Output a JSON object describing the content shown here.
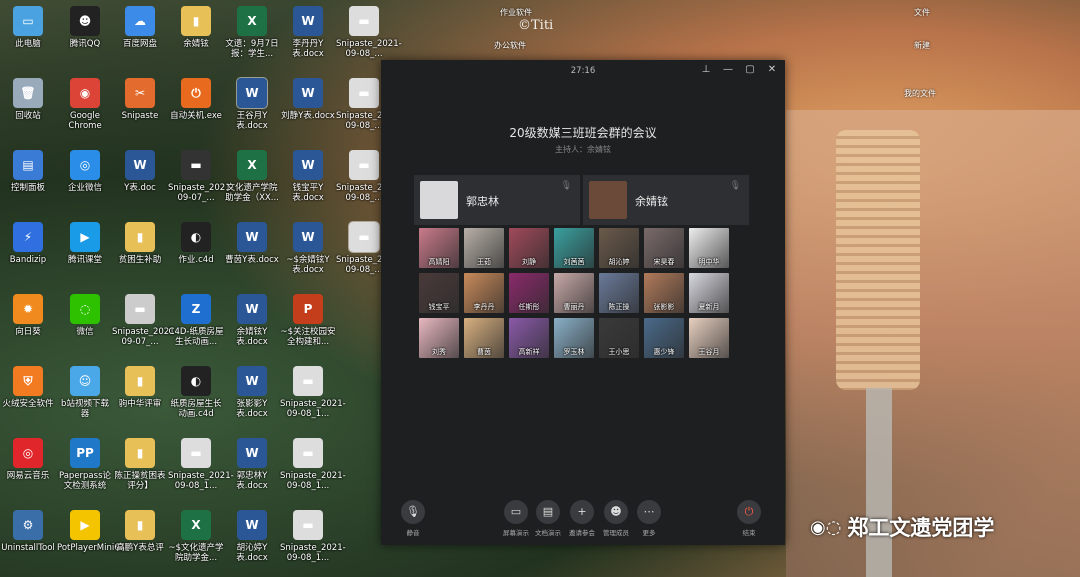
{
  "desktop_icons": [
    {
      "label": "此电脑",
      "color": "#4aa3e0",
      "glyph": "▭",
      "sel": false
    },
    {
      "label": "腾讯QQ",
      "color": "#222",
      "glyph": "☻",
      "sel": false
    },
    {
      "label": "百度网盘",
      "color": "#3d8be8",
      "glyph": "☁",
      "sel": false
    },
    {
      "label": "余婧铉",
      "color": "#e8c058",
      "glyph": "▮",
      "sel": false
    },
    {
      "label": "文遗：9月7日报：学生...",
      "color": "#1e7145",
      "glyph": "X",
      "sel": false
    },
    {
      "label": "李丹丹Y表.docx",
      "color": "#2b5797",
      "glyph": "W",
      "sel": false
    },
    {
      "label": "Snipaste_2021-09-08_...",
      "color": "#ddd",
      "glyph": "▬",
      "sel": false
    },
    {
      "label": "回收站",
      "color": "#9ab",
      "glyph": "🗑",
      "sel": false
    },
    {
      "label": "Google Chrome",
      "color": "#db4437",
      "glyph": "◉",
      "sel": false
    },
    {
      "label": "Snipaste",
      "color": "#e46b2e",
      "glyph": "✂",
      "sel": false
    },
    {
      "label": "自动关机.exe",
      "color": "#e86a1e",
      "glyph": "⏻",
      "sel": false
    },
    {
      "label": "王谷月Y表.docx",
      "color": "#2b5797",
      "glyph": "W",
      "sel": true
    },
    {
      "label": "刘静Y表.docx",
      "color": "#2b5797",
      "glyph": "W",
      "sel": false
    },
    {
      "label": "Snipaste_2021-09-08_...",
      "color": "#ddd",
      "glyph": "▬",
      "sel": false
    },
    {
      "label": "控制面板",
      "color": "#3a7bd5",
      "glyph": "▤",
      "sel": false
    },
    {
      "label": "企业微信",
      "color": "#2a8ee8",
      "glyph": "◎",
      "sel": false
    },
    {
      "label": "Y表.doc",
      "color": "#2b5797",
      "glyph": "W",
      "sel": false
    },
    {
      "label": "Snipaste_2021-09-07_...",
      "color": "#333",
      "glyph": "▬",
      "sel": false
    },
    {
      "label": "文化遗产学院助学金（XX...",
      "color": "#1e7145",
      "glyph": "X",
      "sel": false
    },
    {
      "label": "钱宝平Y表.docx",
      "color": "#2b5797",
      "glyph": "W",
      "sel": false
    },
    {
      "label": "Snipaste_2021-09-08_...",
      "color": "#ddd",
      "glyph": "▬",
      "sel": false
    },
    {
      "label": "Bandizip",
      "color": "#2f6fe0",
      "glyph": "⚡",
      "sel": false
    },
    {
      "label": "腾讯课堂",
      "color": "#1a9be8",
      "glyph": "▶",
      "sel": false
    },
    {
      "label": "贫困生补助",
      "color": "#e8c058",
      "glyph": "▮",
      "sel": false
    },
    {
      "label": "作业.c4d",
      "color": "#222",
      "glyph": "◐",
      "sel": false
    },
    {
      "label": "曹茵Y表.docx",
      "color": "#2b5797",
      "glyph": "W",
      "sel": false
    },
    {
      "label": "~$余婧铉Y表.docx",
      "color": "#2b5797",
      "glyph": "W",
      "sel": false
    },
    {
      "label": "Snipaste_2021-09-08_...",
      "color": "#ddd",
      "glyph": "▬",
      "sel": true
    },
    {
      "label": "向日葵",
      "color": "#f08a1e",
      "glyph": "✹",
      "sel": false
    },
    {
      "label": "微信",
      "color": "#2dc100",
      "glyph": "◌",
      "sel": false
    },
    {
      "label": "Snipaste_2021-09-07_...",
      "color": "#ccc",
      "glyph": "▬",
      "sel": false
    },
    {
      "label": "C4D-纸质房屋生长动画...",
      "color": "#1f6fd0",
      "glyph": "Z",
      "sel": false
    },
    {
      "label": "余婧铉Y表.docx",
      "color": "#2b5797",
      "glyph": "W",
      "sel": false
    },
    {
      "label": "~$关注校园安全构建和...",
      "color": "#c43e1c",
      "glyph": "P",
      "sel": false
    },
    {
      "label": "火绒安全软件",
      "color": "#f27b21",
      "glyph": "⛨",
      "sel": false
    },
    {
      "label": "b站视频下载器",
      "color": "#4aa8e8",
      "glyph": "☺",
      "sel": false
    },
    {
      "label": "驹中华评审",
      "color": "#e8c058",
      "glyph": "▮",
      "sel": false
    },
    {
      "label": "纸质房屋生长动画.c4d",
      "color": "#222",
      "glyph": "◐",
      "sel": false
    },
    {
      "label": "张影影Y表.docx",
      "color": "#2b5797",
      "glyph": "W",
      "sel": false
    },
    {
      "label": "Snipaste_2021-09-08_1...",
      "color": "#ddd",
      "glyph": "▬",
      "sel": false
    },
    {
      "label": "网易云音乐",
      "color": "#e0262a",
      "glyph": "◎",
      "sel": false
    },
    {
      "label": "Paperpass论文检测系统",
      "color": "#1f78c8",
      "glyph": "PP",
      "sel": false
    },
    {
      "label": "陈正操贫困表评分】",
      "color": "#e8c058",
      "glyph": "▮",
      "sel": false
    },
    {
      "label": "Snipaste_2021-09-08_1...",
      "color": "#ddd",
      "glyph": "▬",
      "sel": false
    },
    {
      "label": "郭忠林Y表.docx",
      "color": "#2b5797",
      "glyph": "W",
      "sel": false
    },
    {
      "label": "Snipaste_2021-09-08_1...",
      "color": "#ddd",
      "glyph": "▬",
      "sel": false
    },
    {
      "label": "UninstallTool",
      "color": "#3a6ea8",
      "glyph": "⚙",
      "sel": false
    },
    {
      "label": "PotPlayerMini64",
      "color": "#f5c400",
      "glyph": "▶",
      "sel": false
    },
    {
      "label": "高鹏Y表总评",
      "color": "#e8c058",
      "glyph": "▮",
      "sel": false
    },
    {
      "label": "~$文化遗产学院助学金...",
      "color": "#1e7145",
      "glyph": "X",
      "sel": false
    },
    {
      "label": "胡沁婷Y表.docx",
      "color": "#2b5797",
      "glyph": "W",
      "sel": false
    },
    {
      "label": "Snipaste_2021-09-08_1...",
      "color": "#ddd",
      "glyph": "▬",
      "sel": false
    }
  ],
  "top_labels": {
    "homework_software": "作业软件",
    "office_software": "办公软件",
    "documents": "文件",
    "new": "新建",
    "my_files": "我的文件"
  },
  "watermark": "©Titi",
  "meeting": {
    "timer": "27:16",
    "title": "20级数媒三班班会群的会议",
    "host": "主持人：余婧铉",
    "speakers": [
      {
        "name": "郭忠林",
        "color": "#d9d9dc"
      },
      {
        "name": "余婧铉",
        "color": "#6b4a3a"
      }
    ],
    "participants": [
      {
        "name": "高婧阳",
        "color": "#c97a8a"
      },
      {
        "name": "王茹",
        "color": "#b8b0a8"
      },
      {
        "name": "刘静",
        "color": "#a04a5a"
      },
      {
        "name": "刘茜茜",
        "color": "#3aa0a0"
      },
      {
        "name": "胡沁婷",
        "color": "#6a5a4a"
      },
      {
        "name": "宋昊春",
        "color": "#7a6a6a"
      },
      {
        "name": "明中华",
        "color": "#eeeeee"
      },
      {
        "name": "钱宝平",
        "color": "#4a3a3a"
      },
      {
        "name": "李丹丹",
        "color": "#c88a5a"
      },
      {
        "name": "任斯彤",
        "color": "#8a2a6a"
      },
      {
        "name": "曹丽丹",
        "color": "#c8a8a8"
      },
      {
        "name": "陈正操",
        "color": "#6a7a9a"
      },
      {
        "name": "张影影",
        "color": "#b07a5a"
      },
      {
        "name": "夏新月",
        "color": "#d8d8e0"
      },
      {
        "name": "刘秀",
        "color": "#e8b8c0"
      },
      {
        "name": "曹茵",
        "color": "#d8b080"
      },
      {
        "name": "高新祥",
        "color": "#8a5aa8"
      },
      {
        "name": "罗玉林",
        "color": "#8ab0c8"
      },
      {
        "name": "王小思",
        "color": "#3a3a3a"
      },
      {
        "name": "惠少锋",
        "color": "#4a6a8a"
      },
      {
        "name": "王谷月",
        "color": "#e8d0c0"
      }
    ],
    "controls": [
      {
        "label": "静音",
        "glyph": "🎙"
      },
      {
        "label": "屏幕演示",
        "glyph": "▭"
      },
      {
        "label": "文档演示",
        "glyph": "▤"
      },
      {
        "label": "邀请参会",
        "glyph": "+"
      },
      {
        "label": "管理成员",
        "glyph": "☻"
      },
      {
        "label": "更多",
        "glyph": "⋯"
      },
      {
        "label": "结束",
        "glyph": "⏻"
      }
    ]
  },
  "brand": {
    "wechat_glyph": "◉◌",
    "name": "郑工文遗党团学"
  }
}
